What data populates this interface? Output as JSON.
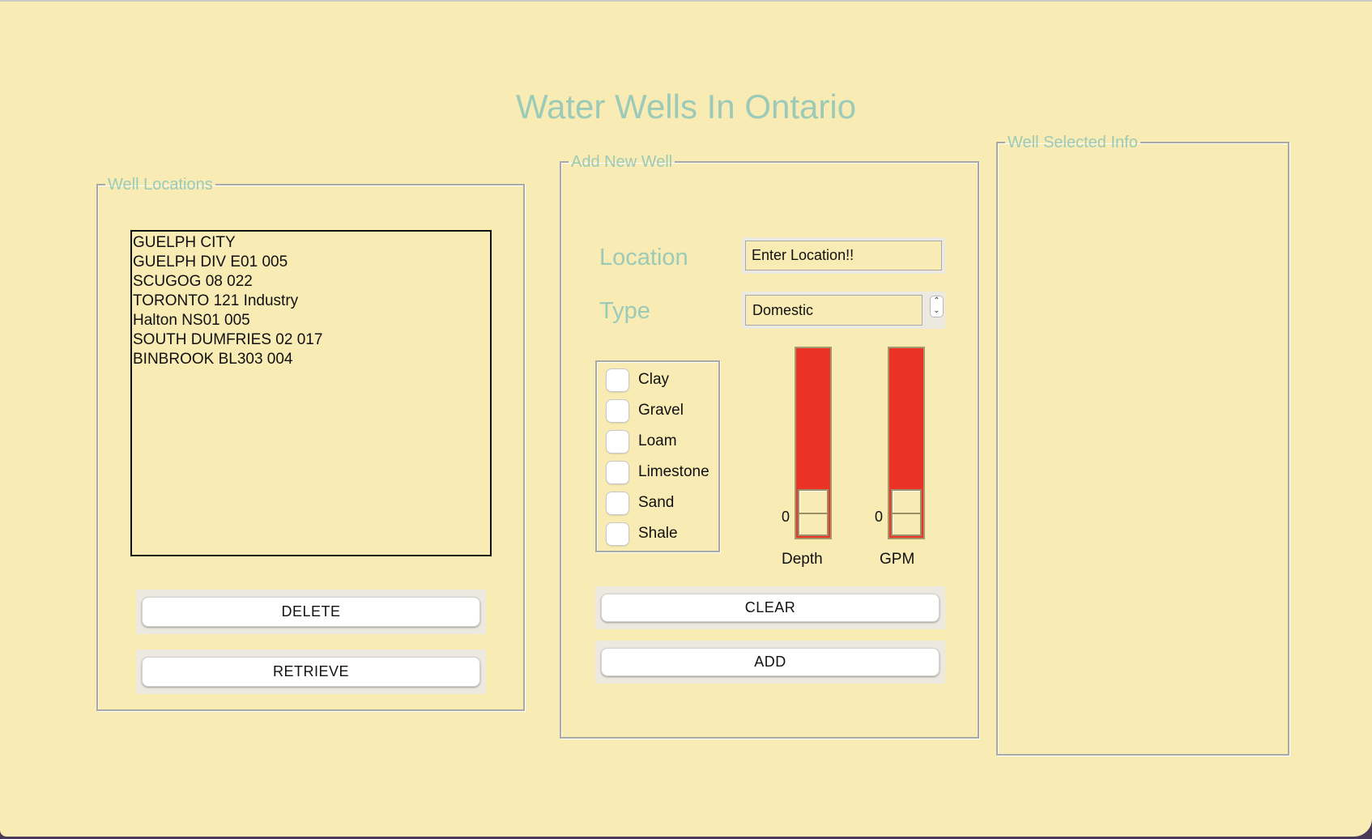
{
  "app": {
    "title": "Water Wells In Ontario"
  },
  "well_locations": {
    "legend": "Well Locations",
    "items": [
      "GUELPH CITY",
      "GUELPH DIV E01 005",
      "SCUGOG 08 022",
      "TORONTO 121 Industry",
      "Halton NS01 005",
      "SOUTH DUMFRIES 02 017",
      "BINBROOK BL303 004"
    ],
    "delete_label": "DELETE",
    "retrieve_label": "RETRIEVE"
  },
  "add_new_well": {
    "legend": "Add New Well",
    "location_label": "Location",
    "location_value": "Enter Location!!",
    "type_label": "Type",
    "type_value": "Domestic",
    "soil_types": [
      "Clay",
      "Gravel",
      "Loam",
      "Limestone",
      "Sand",
      "Shale"
    ],
    "depth": {
      "label": "Depth",
      "value": "0"
    },
    "gpm": {
      "label": "GPM",
      "value": "0"
    },
    "clear_label": "CLEAR",
    "add_label": "ADD",
    "slider_color": "#ea3324"
  },
  "well_selected_info": {
    "legend": "Well Selected Info"
  },
  "theme": {
    "background": "#f8ebb4",
    "accent": "#9ccab8"
  }
}
